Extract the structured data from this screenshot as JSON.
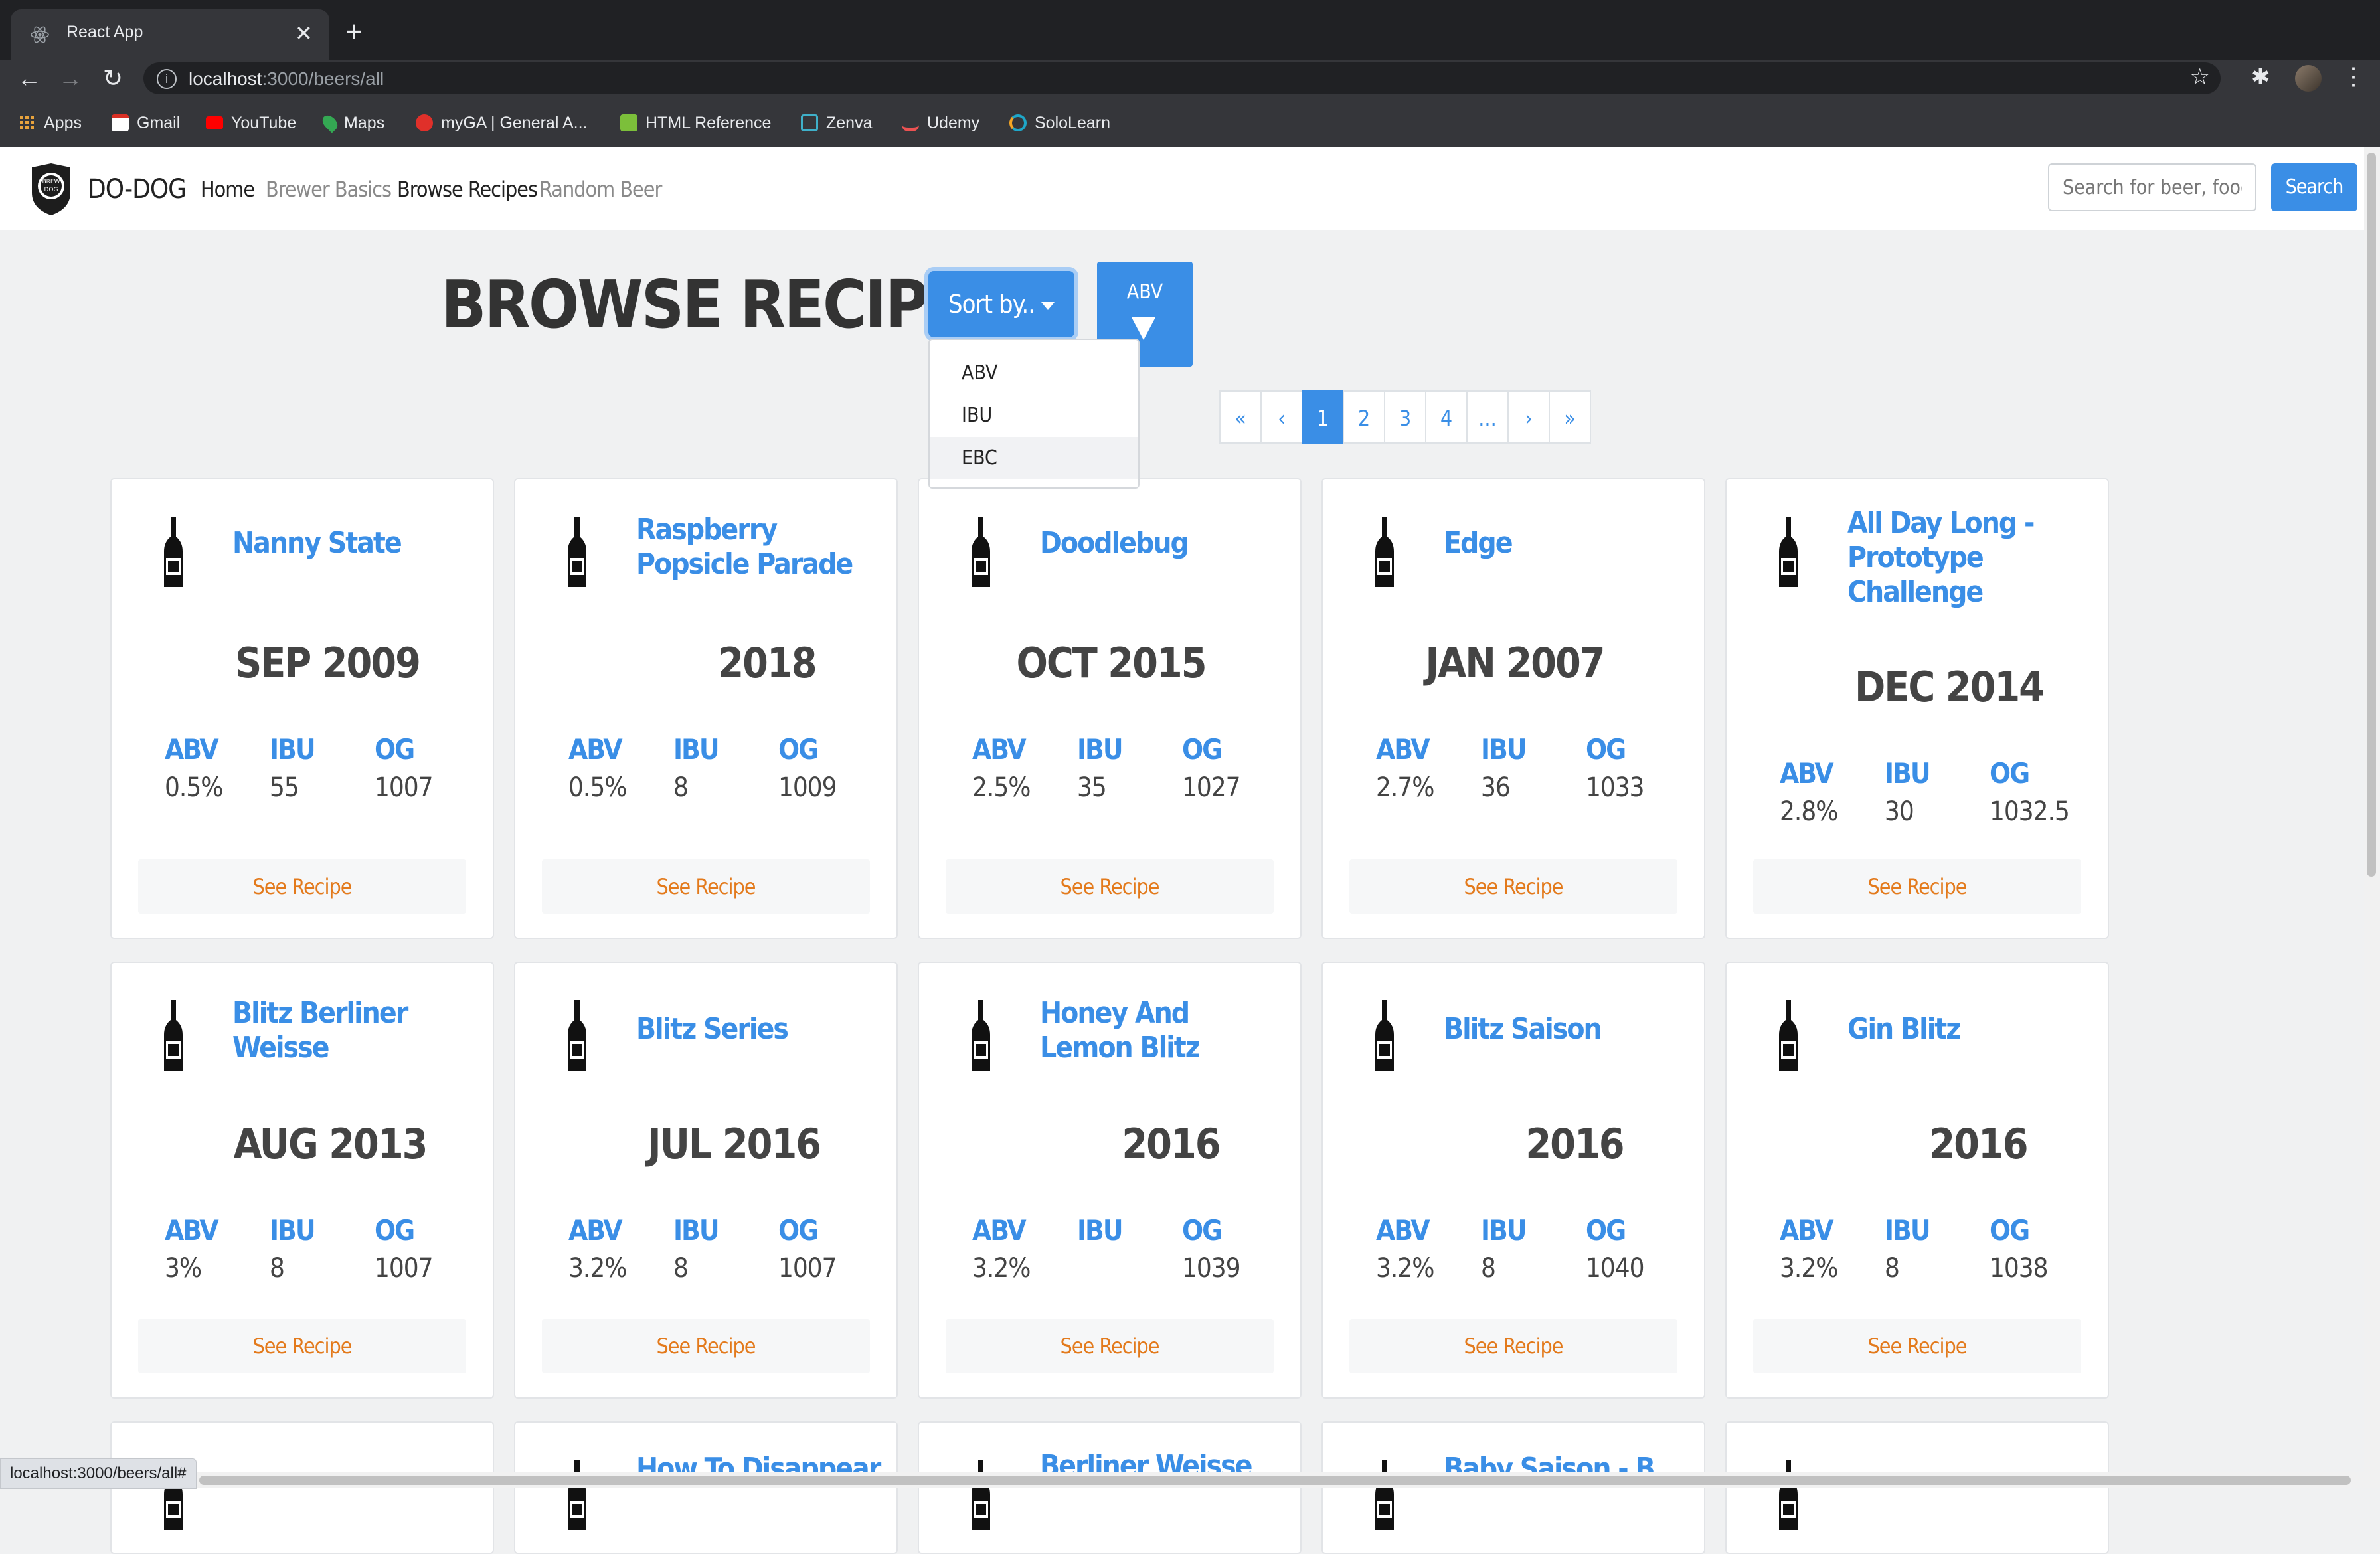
{
  "browser": {
    "tab_title": "React App",
    "url_host": "localhost",
    "url_path": ":3000/beers/all",
    "bookmarks": [
      "Apps",
      "Gmail",
      "YouTube",
      "Maps",
      "myGA | General A...",
      "HTML Reference",
      "Zenva",
      "Udemy",
      "SoloLearn"
    ],
    "status_url": "localhost:3000/beers/all#"
  },
  "navbar": {
    "brand": "DO-DOG",
    "links": [
      "Home",
      "Brewer Basics",
      "Browse Recipes",
      "Random Beer"
    ],
    "search_placeholder": "Search for beer, food..",
    "search_button": "Search"
  },
  "page": {
    "title": "BROWSE RECIPES",
    "sort_button": "Sort by..",
    "sort_toggle": "ABV",
    "sort_options": [
      "ABV",
      "IBU",
      "EBC"
    ],
    "pagination": [
      "«",
      "‹",
      "1",
      "2",
      "3",
      "4",
      "...",
      "›",
      "»"
    ],
    "active_page": "1"
  },
  "stat_labels": {
    "abv": "ABV",
    "ibu": "IBU",
    "og": "OG"
  },
  "cards": [
    {
      "name": "Nanny State",
      "date": "SEP 2009",
      "abv": "0.5%",
      "ibu": "55",
      "og": "1007",
      "button": "See Recipe"
    },
    {
      "name": "Raspberry Popsicle Parade",
      "date": "2018",
      "abv": "0.5%",
      "ibu": "8",
      "og": "1009",
      "button": "See Recipe"
    },
    {
      "name": "Doodlebug",
      "date": "OCT 2015",
      "abv": "2.5%",
      "ibu": "35",
      "og": "1027",
      "button": "See Recipe"
    },
    {
      "name": "Edge",
      "date": "JAN 2007",
      "abv": "2.7%",
      "ibu": "36",
      "og": "1033",
      "button": "See Recipe"
    },
    {
      "name": "All Day Long - Prototype Challenge",
      "date": "DEC 2014",
      "abv": "2.8%",
      "ibu": "30",
      "og": "1032.5",
      "button": "See Recipe"
    },
    {
      "name": "Blitz Berliner Weisse",
      "date": "AUG 2013",
      "abv": "3%",
      "ibu": "8",
      "og": "1007",
      "button": "See Recipe"
    },
    {
      "name": "Blitz Series",
      "date": "JUL 2016",
      "abv": "3.2%",
      "ibu": "8",
      "og": "1007",
      "button": "See Recipe"
    },
    {
      "name": "Honey And Lemon Blitz",
      "date": "2016",
      "abv": "3.2%",
      "ibu": "",
      "og": "1039",
      "button": "See Recipe"
    },
    {
      "name": "Blitz Saison",
      "date": "2016",
      "abv": "3.2%",
      "ibu": "8",
      "og": "1040",
      "button": "See Recipe"
    },
    {
      "name": "Gin Blitz",
      "date": "2016",
      "abv": "3.2%",
      "ibu": "8",
      "og": "1038",
      "button": "See Recipe"
    },
    {
      "name": "",
      "date": "",
      "abv": "",
      "ibu": "",
      "og": "",
      "button": ""
    },
    {
      "name": "How To Disappear",
      "date": "",
      "abv": "",
      "ibu": "",
      "og": "",
      "button": ""
    },
    {
      "name": "Berliner Weisse",
      "date": "",
      "abv": "",
      "ibu": "",
      "og": "",
      "button": ""
    },
    {
      "name": "Baby Saison - B",
      "date": "",
      "abv": "",
      "ibu": "",
      "og": "",
      "button": ""
    },
    {
      "name": "",
      "date": "",
      "abv": "",
      "ibu": "",
      "og": "",
      "button": ""
    }
  ]
}
